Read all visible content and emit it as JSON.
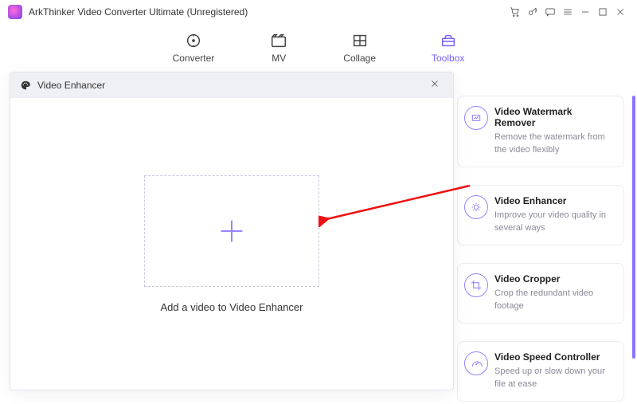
{
  "app": {
    "title": "ArkThinker Video Converter Ultimate (Unregistered)"
  },
  "nav": {
    "converter": "Converter",
    "mv": "MV",
    "collage": "Collage",
    "toolbox": "Toolbox"
  },
  "modal": {
    "title": "Video Enhancer",
    "drop_caption": "Add a video to Video Enhancer"
  },
  "cards": {
    "watermark": {
      "title": "Video Watermark Remover",
      "desc": "Remove the watermark from the video flexibly"
    },
    "enhancer": {
      "title": "Video Enhancer",
      "desc": "Improve your video quality in several ways"
    },
    "cropper": {
      "title": "Video Cropper",
      "desc": "Crop the redundant video footage"
    },
    "speed": {
      "title": "Video Speed Controller",
      "desc": "Speed up or slow down your file at ease"
    }
  }
}
